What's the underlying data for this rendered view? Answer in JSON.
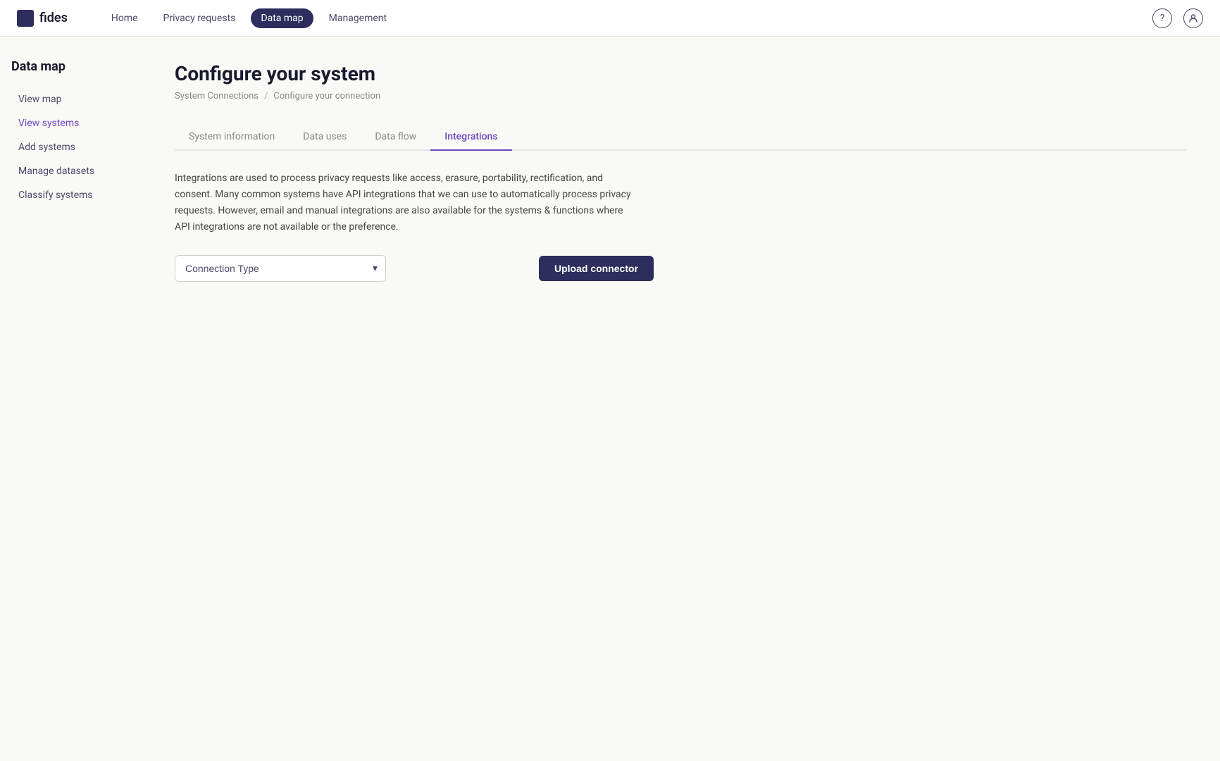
{
  "app": {
    "logo_text": "fides"
  },
  "nav": {
    "links": [
      {
        "label": "Home",
        "active": false
      },
      {
        "label": "Privacy requests",
        "active": false
      },
      {
        "label": "Data map",
        "active": true
      },
      {
        "label": "Management",
        "active": false
      }
    ]
  },
  "sidebar": {
    "title": "Data map",
    "items": [
      {
        "label": "View map",
        "active": false
      },
      {
        "label": "View systems",
        "active": true
      },
      {
        "label": "Add systems",
        "active": false
      },
      {
        "label": "Manage datasets",
        "active": false
      },
      {
        "label": "Classify systems",
        "active": false
      }
    ]
  },
  "content": {
    "page_title": "Configure your system",
    "breadcrumb": {
      "part1": "System Connections",
      "separator": "/",
      "part2": "Configure your connection"
    },
    "tabs": [
      {
        "label": "System information",
        "active": false
      },
      {
        "label": "Data uses",
        "active": false
      },
      {
        "label": "Data flow",
        "active": false
      },
      {
        "label": "Integrations",
        "active": true
      }
    ],
    "description": "Integrations are used to process privacy requests like access, erasure, portability, rectification, and consent. Many common systems have API integrations that we can use to automatically process privacy requests. However, email and manual integrations are also available for the systems & functions where API integrations are not available or the preference.",
    "connection_type": {
      "placeholder": "Connection Type",
      "chevron": "▾"
    },
    "upload_button_label": "Upload connector"
  }
}
